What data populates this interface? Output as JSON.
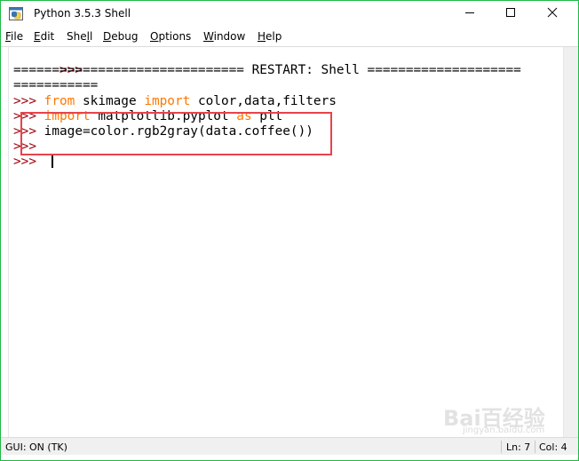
{
  "window": {
    "title": "Python 3.5.3 Shell",
    "icon": "python-icon",
    "controls": [
      "minimize-icon",
      "maximize-icon",
      "close-icon"
    ],
    "accent_color": "#1fb845"
  },
  "menu": {
    "file": {
      "acc": "F",
      "rest": "ile"
    },
    "edit": {
      "acc": "E",
      "rest": "dit"
    },
    "shell": {
      "pre": "She",
      "acc": "l",
      "rest": "l"
    },
    "debug": {
      "acc": "D",
      "rest": "ebug"
    },
    "options": {
      "acc": "O",
      "rest": "ptions"
    },
    "window": {
      "acc": "W",
      "rest": "indow"
    },
    "help": {
      "acc": "H",
      "rest": "elp"
    }
  },
  "shell": {
    "prompt": ">>>",
    "restart_line1": "============================== RESTART: Shell ====================",
    "restart_line2": "===========",
    "line3_kw1": "from",
    "line3_mod": " skimage ",
    "line3_kw2": "import",
    "line3_rest": " color,data,filters",
    "line4_kw1": "import",
    "line4_mod": " matplotlib.pyplot ",
    "line4_kw2": "as",
    "line4_rest": " plt",
    "line5_code": " image=color.rgb2gray(data.coffee())",
    "prompt_color": "#a0000a",
    "keyword_color": "#ff7700",
    "highlight_color": "#e8434a"
  },
  "status": {
    "gui": "GUI: ON (TK)",
    "ln": "Ln: 7",
    "col": "Col: 4"
  },
  "watermark": {
    "main": "Bai百经验",
    "sub": "jingyan.baidu.com"
  }
}
